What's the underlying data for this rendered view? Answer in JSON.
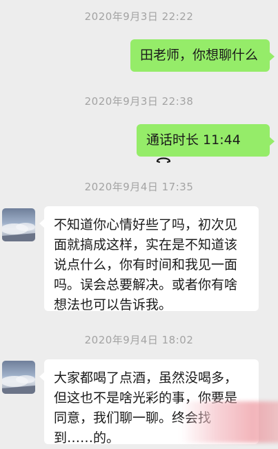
{
  "messages": [
    {
      "timestamp": "2020年9月3日 22:22"
    },
    {
      "sender": "me",
      "text": "田老师，你想聊什么"
    },
    {
      "timestamp": "2020年9月3日 22:38"
    },
    {
      "sender": "me",
      "call_label": "通话时长 11:44",
      "icon": "phone-hangup-icon"
    },
    {
      "timestamp": "2020年9月4日 17:35"
    },
    {
      "sender": "other",
      "text": "不知道你心情好些了吗，初次见面就搞成这样，实在是不知道该说点什么，你有时间和我见一面吗。误会总要解决。或者你有啥想法也可以告诉我。"
    },
    {
      "timestamp": "2020年9月4日 18:02"
    },
    {
      "sender": "other",
      "text": "大家都喝了点酒，虽然没喝多，但这也不是啥光彩的事，你要是同意，我们聊一聊。终会找到……的。"
    }
  ],
  "colors": {
    "background": "#ededed",
    "my_bubble": "#95ec69",
    "their_bubble": "#ffffff",
    "timestamp_text": "#a3a3a3"
  }
}
